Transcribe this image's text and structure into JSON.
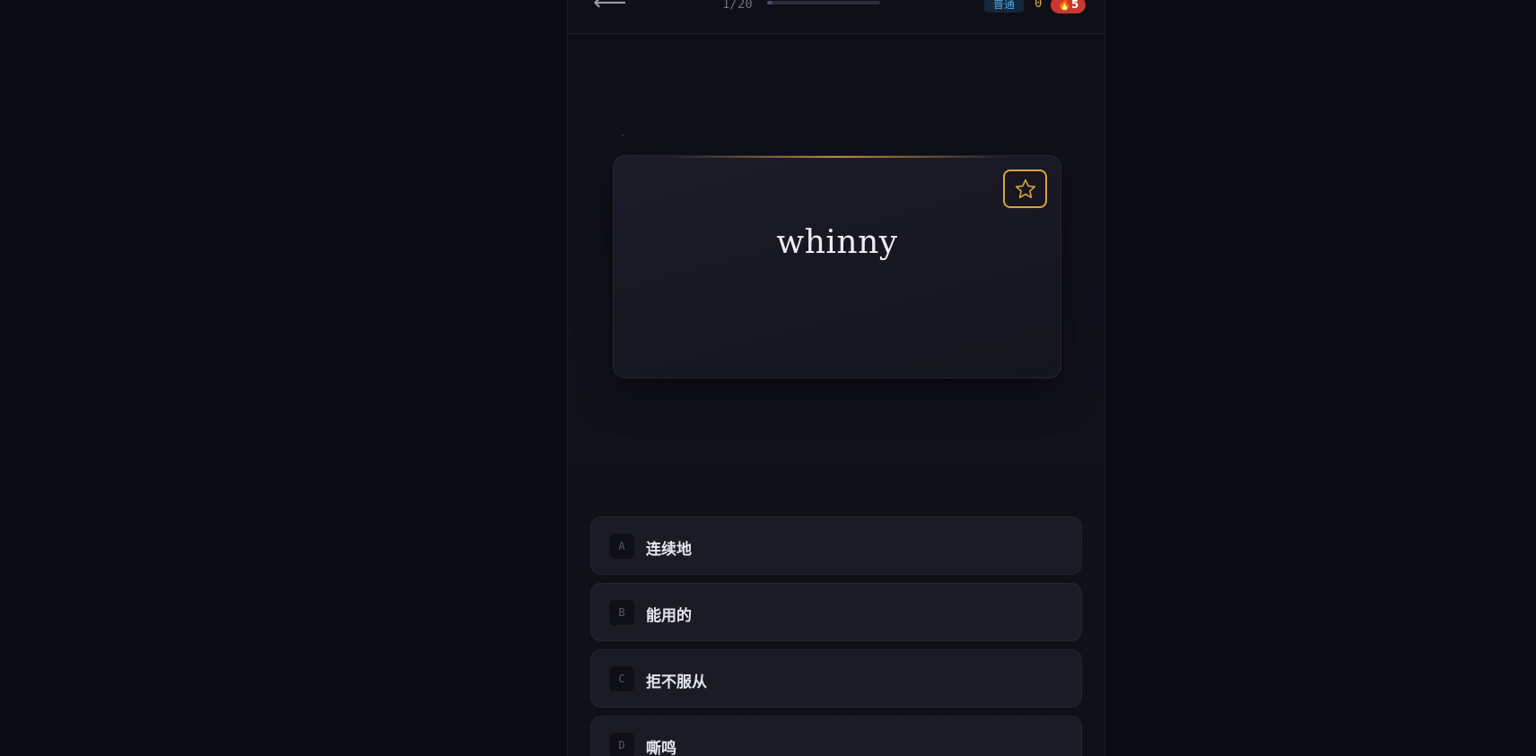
{
  "header": {
    "back_icon": "arrow-left-icon",
    "back_glyph": "⟵",
    "progress_text": "1/20",
    "progress_fraction": 0.05,
    "level": "普通",
    "score": "0",
    "streak": "🔥5",
    "colors": {
      "score": "#e0a534",
      "streak_bg": "#c8382f",
      "level_fg": "#4ea8e6"
    }
  },
  "card": {
    "word": "whinny",
    "favorite_icon": "star-icon",
    "accent": "#d9a33a"
  },
  "options": [
    {
      "key": "A",
      "text": "连续地"
    },
    {
      "key": "B",
      "text": "能用的"
    },
    {
      "key": "C",
      "text": "拒不服从"
    },
    {
      "key": "D",
      "text": "嘶鸣"
    }
  ]
}
